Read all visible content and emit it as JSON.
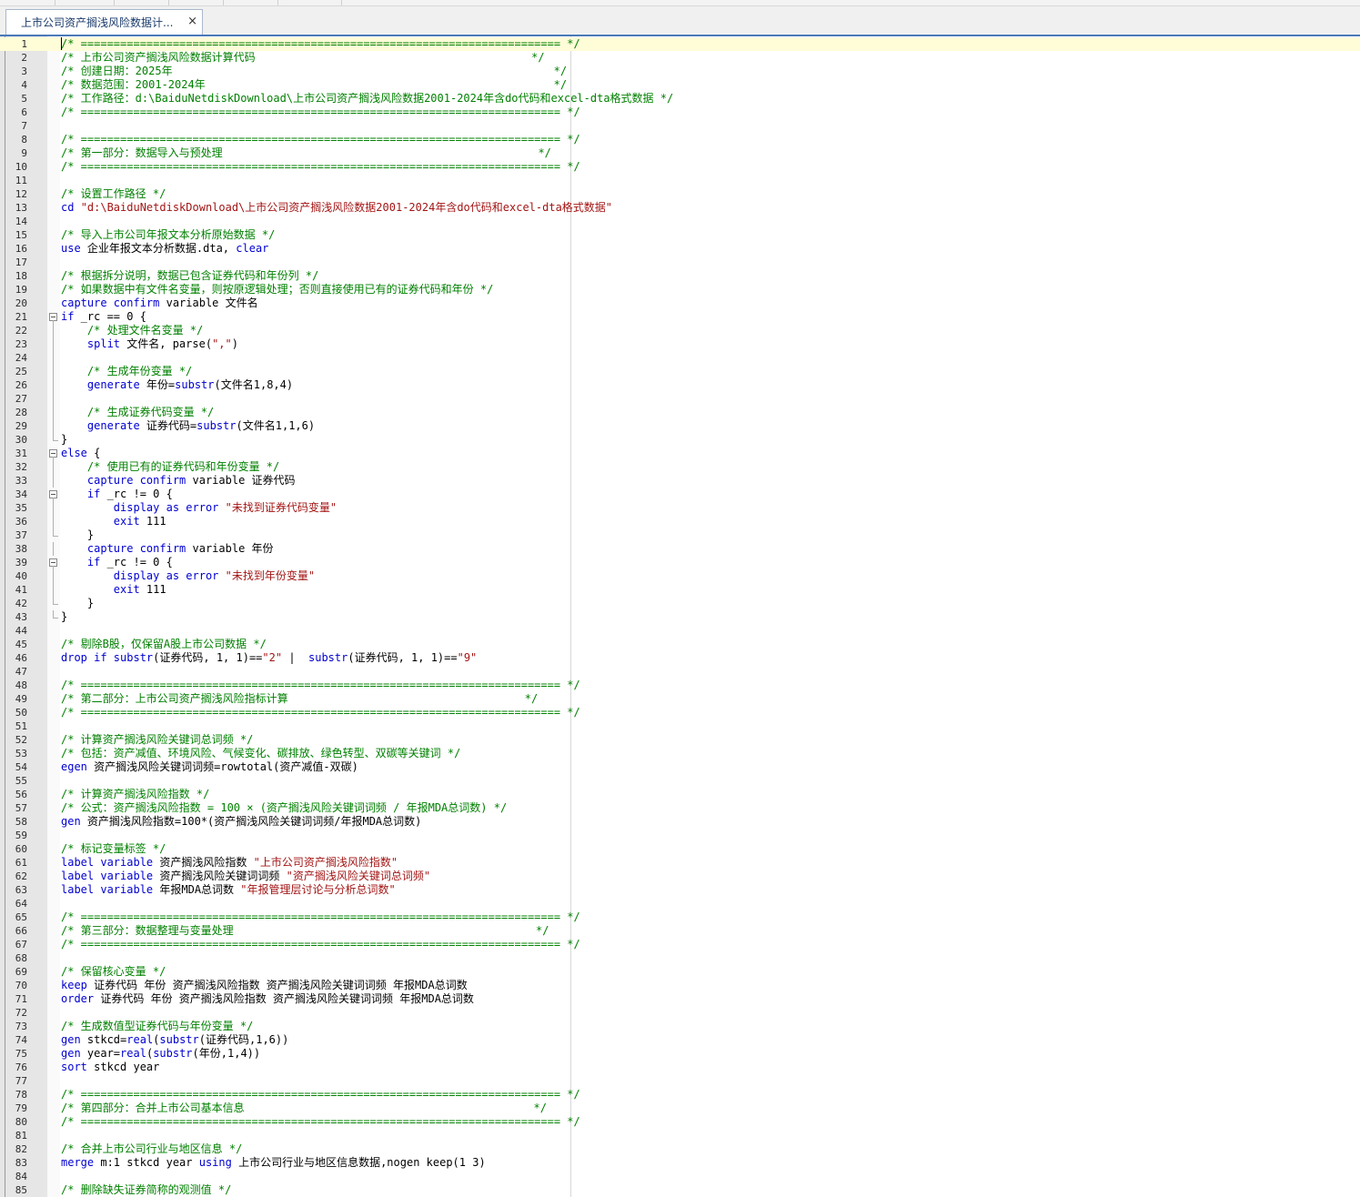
{
  "tab": {
    "title": "上市公司资产搁浅风险数据计...",
    "close_icon": "×"
  },
  "lines": [
    {
      "n": "1",
      "fold": "",
      "segs": [
        [
          "c",
          "/* ========================================================================= */"
        ]
      ]
    },
    {
      "n": "2",
      "fold": "",
      "segs": [
        [
          "c",
          "/* 上市公司资产搁浅风险数据计算代码                                          */"
        ]
      ]
    },
    {
      "n": "3",
      "fold": "",
      "segs": [
        [
          "c",
          "/* 创建日期：2025年                                                          */"
        ]
      ]
    },
    {
      "n": "4",
      "fold": "",
      "segs": [
        [
          "c",
          "/* 数据范围：2001-2024年                                                     */"
        ]
      ]
    },
    {
      "n": "5",
      "fold": "",
      "segs": [
        [
          "c",
          "/* 工作路径：d:\\BaiduNetdiskDownload\\上市公司资产搁浅风险数据2001-2024年含do代码和excel-dta格式数据 */"
        ]
      ]
    },
    {
      "n": "6",
      "fold": "",
      "segs": [
        [
          "c",
          "/* ========================================================================= */"
        ]
      ]
    },
    {
      "n": "7",
      "fold": "",
      "segs": []
    },
    {
      "n": "8",
      "fold": "",
      "segs": [
        [
          "c",
          "/* ========================================================================= */"
        ]
      ]
    },
    {
      "n": "9",
      "fold": "",
      "segs": [
        [
          "c",
          "/* 第一部分：数据导入与预处理                                                */"
        ]
      ]
    },
    {
      "n": "10",
      "fold": "",
      "segs": [
        [
          "c",
          "/* ========================================================================= */"
        ]
      ]
    },
    {
      "n": "11",
      "fold": "",
      "segs": []
    },
    {
      "n": "12",
      "fold": "",
      "segs": [
        [
          "c",
          "/* 设置工作路径 */"
        ]
      ]
    },
    {
      "n": "13",
      "fold": "",
      "segs": [
        [
          "k",
          "cd "
        ],
        [
          "s",
          "\"d:\\BaiduNetdiskDownload\\上市公司资产搁浅风险数据2001-2024年含do代码和excel-dta格式数据\""
        ]
      ]
    },
    {
      "n": "14",
      "fold": "",
      "segs": []
    },
    {
      "n": "15",
      "fold": "",
      "segs": [
        [
          "c",
          "/* 导入上市公司年报文本分析原始数据 */"
        ]
      ]
    },
    {
      "n": "16",
      "fold": "",
      "segs": [
        [
          "k",
          "use"
        ],
        [
          "p",
          " 企业年报文本分析数据.dta, "
        ],
        [
          "k",
          "clear"
        ]
      ]
    },
    {
      "n": "17",
      "fold": "",
      "segs": []
    },
    {
      "n": "18",
      "fold": "",
      "segs": [
        [
          "c",
          "/* 根据拆分说明，数据已包含证券代码和年份列 */"
        ]
      ]
    },
    {
      "n": "19",
      "fold": "",
      "segs": [
        [
          "c",
          "/* 如果数据中有文件名变量，则按原逻辑处理；否则直接使用已有的证券代码和年份 */"
        ]
      ]
    },
    {
      "n": "20",
      "fold": "",
      "segs": [
        [
          "k",
          "capture confirm"
        ],
        [
          "p",
          " variable 文件名"
        ]
      ]
    },
    {
      "n": "21",
      "fold": "box",
      "segs": [
        [
          "k",
          "if"
        ],
        [
          "p",
          " _rc == 0 {"
        ]
      ]
    },
    {
      "n": "22",
      "fold": "line",
      "segs": [
        [
          "p",
          "    "
        ],
        [
          "c",
          "/* 处理文件名变量 */"
        ]
      ]
    },
    {
      "n": "23",
      "fold": "line",
      "segs": [
        [
          "p",
          "    "
        ],
        [
          "k",
          "split"
        ],
        [
          "p",
          " 文件名, parse("
        ],
        [
          "s",
          "\",\""
        ],
        [
          "p",
          ")"
        ]
      ]
    },
    {
      "n": "24",
      "fold": "line",
      "segs": []
    },
    {
      "n": "25",
      "fold": "line",
      "segs": [
        [
          "p",
          "    "
        ],
        [
          "c",
          "/* 生成年份变量 */"
        ]
      ]
    },
    {
      "n": "26",
      "fold": "line",
      "segs": [
        [
          "p",
          "    "
        ],
        [
          "k",
          "generate"
        ],
        [
          "p",
          " 年份="
        ],
        [
          "k",
          "substr"
        ],
        [
          "p",
          "(文件名1,8,4)"
        ]
      ]
    },
    {
      "n": "27",
      "fold": "line",
      "segs": []
    },
    {
      "n": "28",
      "fold": "line",
      "segs": [
        [
          "p",
          "    "
        ],
        [
          "c",
          "/* 生成证券代码变量 */"
        ]
      ]
    },
    {
      "n": "29",
      "fold": "line",
      "segs": [
        [
          "p",
          "    "
        ],
        [
          "k",
          "generate"
        ],
        [
          "p",
          " 证券代码="
        ],
        [
          "k",
          "substr"
        ],
        [
          "p",
          "(文件名1,1,6)"
        ]
      ]
    },
    {
      "n": "30",
      "fold": "end",
      "segs": [
        [
          "p",
          "}"
        ]
      ]
    },
    {
      "n": "31",
      "fold": "box",
      "segs": [
        [
          "k",
          "else"
        ],
        [
          "p",
          " {"
        ]
      ]
    },
    {
      "n": "32",
      "fold": "line",
      "segs": [
        [
          "p",
          "    "
        ],
        [
          "c",
          "/* 使用已有的证券代码和年份变量 */"
        ]
      ]
    },
    {
      "n": "33",
      "fold": "line",
      "segs": [
        [
          "p",
          "    "
        ],
        [
          "k",
          "capture confirm"
        ],
        [
          "p",
          " variable 证券代码"
        ]
      ]
    },
    {
      "n": "34",
      "fold": "box",
      "segs": [
        [
          "p",
          "    "
        ],
        [
          "k",
          "if"
        ],
        [
          "p",
          " _rc != 0 {"
        ]
      ]
    },
    {
      "n": "35",
      "fold": "line",
      "segs": [
        [
          "p",
          "        "
        ],
        [
          "k",
          "display as error"
        ],
        [
          "p",
          " "
        ],
        [
          "s",
          "\"未找到证券代码变量\""
        ]
      ]
    },
    {
      "n": "36",
      "fold": "line",
      "segs": [
        [
          "p",
          "        "
        ],
        [
          "k",
          "exit"
        ],
        [
          "p",
          " 111"
        ]
      ]
    },
    {
      "n": "37",
      "fold": "end",
      "segs": [
        [
          "p",
          "    }"
        ]
      ]
    },
    {
      "n": "38",
      "fold": "line",
      "segs": [
        [
          "p",
          "    "
        ],
        [
          "k",
          "capture confirm"
        ],
        [
          "p",
          " variable 年份"
        ]
      ]
    },
    {
      "n": "39",
      "fold": "box",
      "segs": [
        [
          "p",
          "    "
        ],
        [
          "k",
          "if"
        ],
        [
          "p",
          " _rc != 0 {"
        ]
      ]
    },
    {
      "n": "40",
      "fold": "line",
      "segs": [
        [
          "p",
          "        "
        ],
        [
          "k",
          "display as error"
        ],
        [
          "p",
          " "
        ],
        [
          "s",
          "\"未找到年份变量\""
        ]
      ]
    },
    {
      "n": "41",
      "fold": "line",
      "segs": [
        [
          "p",
          "        "
        ],
        [
          "k",
          "exit"
        ],
        [
          "p",
          " 111"
        ]
      ]
    },
    {
      "n": "42",
      "fold": "end",
      "segs": [
        [
          "p",
          "    }"
        ]
      ]
    },
    {
      "n": "43",
      "fold": "end",
      "segs": [
        [
          "p",
          "}"
        ]
      ]
    },
    {
      "n": "44",
      "fold": "",
      "segs": []
    },
    {
      "n": "45",
      "fold": "",
      "segs": [
        [
          "c",
          "/* 剔除B股，仅保留A股上市公司数据 */"
        ]
      ]
    },
    {
      "n": "46",
      "fold": "",
      "segs": [
        [
          "k",
          "drop if substr"
        ],
        [
          "p",
          "(证券代码, 1, 1)=="
        ],
        [
          "s",
          "\"2\""
        ],
        [
          "p",
          " |  "
        ],
        [
          "k",
          "substr"
        ],
        [
          "p",
          "(证券代码, 1, 1)=="
        ],
        [
          "s",
          "\"9\""
        ]
      ]
    },
    {
      "n": "47",
      "fold": "",
      "segs": []
    },
    {
      "n": "48",
      "fold": "",
      "segs": [
        [
          "c",
          "/* ========================================================================= */"
        ]
      ]
    },
    {
      "n": "49",
      "fold": "",
      "segs": [
        [
          "c",
          "/* 第二部分：上市公司资产搁浅风险指标计算                                    */"
        ]
      ]
    },
    {
      "n": "50",
      "fold": "",
      "segs": [
        [
          "c",
          "/* ========================================================================= */"
        ]
      ]
    },
    {
      "n": "51",
      "fold": "",
      "segs": []
    },
    {
      "n": "52",
      "fold": "",
      "segs": [
        [
          "c",
          "/* 计算资产搁浅风险关键词总词频 */"
        ]
      ]
    },
    {
      "n": "53",
      "fold": "",
      "segs": [
        [
          "c",
          "/* 包括：资产减值、环境风险、气候变化、碳排放、绿色转型、双碳等关键词 */"
        ]
      ]
    },
    {
      "n": "54",
      "fold": "",
      "segs": [
        [
          "k",
          "egen"
        ],
        [
          "p",
          " 资产搁浅风险关键词词频=rowtotal(资产减值-双碳)"
        ]
      ]
    },
    {
      "n": "55",
      "fold": "",
      "segs": []
    },
    {
      "n": "56",
      "fold": "",
      "segs": [
        [
          "c",
          "/* 计算资产搁浅风险指数 */"
        ]
      ]
    },
    {
      "n": "57",
      "fold": "",
      "segs": [
        [
          "c",
          "/* 公式：资产搁浅风险指数 = 100 × (资产搁浅风险关键词词频 / 年报MDA总词数) */"
        ]
      ]
    },
    {
      "n": "58",
      "fold": "",
      "segs": [
        [
          "k",
          "gen"
        ],
        [
          "p",
          " 资产搁浅风险指数=100*(资产搁浅风险关键词词频/年报MDA总词数)"
        ]
      ]
    },
    {
      "n": "59",
      "fold": "",
      "segs": []
    },
    {
      "n": "60",
      "fold": "",
      "segs": [
        [
          "c",
          "/* 标记变量标签 */"
        ]
      ]
    },
    {
      "n": "61",
      "fold": "",
      "segs": [
        [
          "k",
          "label variable"
        ],
        [
          "p",
          " 资产搁浅风险指数 "
        ],
        [
          "s",
          "\"上市公司资产搁浅风险指数\""
        ]
      ]
    },
    {
      "n": "62",
      "fold": "",
      "segs": [
        [
          "k",
          "label variable"
        ],
        [
          "p",
          " 资产搁浅风险关键词词频 "
        ],
        [
          "s",
          "\"资产搁浅风险关键词总词频\""
        ]
      ]
    },
    {
      "n": "63",
      "fold": "",
      "segs": [
        [
          "k",
          "label variable"
        ],
        [
          "p",
          " 年报MDA总词数 "
        ],
        [
          "s",
          "\"年报管理层讨论与分析总词数\""
        ]
      ]
    },
    {
      "n": "64",
      "fold": "",
      "segs": []
    },
    {
      "n": "65",
      "fold": "",
      "segs": [
        [
          "c",
          "/* ========================================================================= */"
        ]
      ]
    },
    {
      "n": "66",
      "fold": "",
      "segs": [
        [
          "c",
          "/* 第三部分：数据整理与变量处理                                              */"
        ]
      ]
    },
    {
      "n": "67",
      "fold": "",
      "segs": [
        [
          "c",
          "/* ========================================================================= */"
        ]
      ]
    },
    {
      "n": "68",
      "fold": "",
      "segs": []
    },
    {
      "n": "69",
      "fold": "",
      "segs": [
        [
          "c",
          "/* 保留核心变量 */"
        ]
      ]
    },
    {
      "n": "70",
      "fold": "",
      "segs": [
        [
          "k",
          "keep"
        ],
        [
          "p",
          " 证券代码 年份 资产搁浅风险指数 资产搁浅风险关键词词频 年报MDA总词数"
        ]
      ]
    },
    {
      "n": "71",
      "fold": "",
      "segs": [
        [
          "k",
          "order"
        ],
        [
          "p",
          " 证券代码 年份 资产搁浅风险指数 资产搁浅风险关键词词频 年报MDA总词数"
        ]
      ]
    },
    {
      "n": "72",
      "fold": "",
      "segs": []
    },
    {
      "n": "73",
      "fold": "",
      "segs": [
        [
          "c",
          "/* 生成数值型证券代码与年份变量 */"
        ]
      ]
    },
    {
      "n": "74",
      "fold": "",
      "segs": [
        [
          "k",
          "gen"
        ],
        [
          "p",
          " stkcd="
        ],
        [
          "k",
          "real"
        ],
        [
          "p",
          "("
        ],
        [
          "k",
          "substr"
        ],
        [
          "p",
          "(证券代码,1,6))"
        ]
      ]
    },
    {
      "n": "75",
      "fold": "",
      "segs": [
        [
          "k",
          "gen"
        ],
        [
          "p",
          " year="
        ],
        [
          "k",
          "real"
        ],
        [
          "p",
          "("
        ],
        [
          "k",
          "substr"
        ],
        [
          "p",
          "(年份,1,4))"
        ]
      ]
    },
    {
      "n": "76",
      "fold": "",
      "segs": [
        [
          "k",
          "sort"
        ],
        [
          "p",
          " stkcd year"
        ]
      ]
    },
    {
      "n": "77",
      "fold": "",
      "segs": []
    },
    {
      "n": "78",
      "fold": "",
      "segs": [
        [
          "c",
          "/* ========================================================================= */"
        ]
      ]
    },
    {
      "n": "79",
      "fold": "",
      "segs": [
        [
          "c",
          "/* 第四部分：合并上市公司基本信息                                            */"
        ]
      ]
    },
    {
      "n": "80",
      "fold": "",
      "segs": [
        [
          "c",
          "/* ========================================================================= */"
        ]
      ]
    },
    {
      "n": "81",
      "fold": "",
      "segs": []
    },
    {
      "n": "82",
      "fold": "",
      "segs": [
        [
          "c",
          "/* 合并上市公司行业与地区信息 */"
        ]
      ]
    },
    {
      "n": "83",
      "fold": "",
      "segs": [
        [
          "k",
          "merge"
        ],
        [
          "p",
          " m:1 stkcd year "
        ],
        [
          "k",
          "using"
        ],
        [
          "p",
          " 上市公司行业与地区信息数据,nogen keep(1 3)"
        ]
      ]
    },
    {
      "n": "84",
      "fold": "",
      "segs": []
    },
    {
      "n": "85",
      "fold": "",
      "segs": [
        [
          "c",
          "/* 删除缺失证券简称的观测值 */"
        ]
      ]
    }
  ]
}
